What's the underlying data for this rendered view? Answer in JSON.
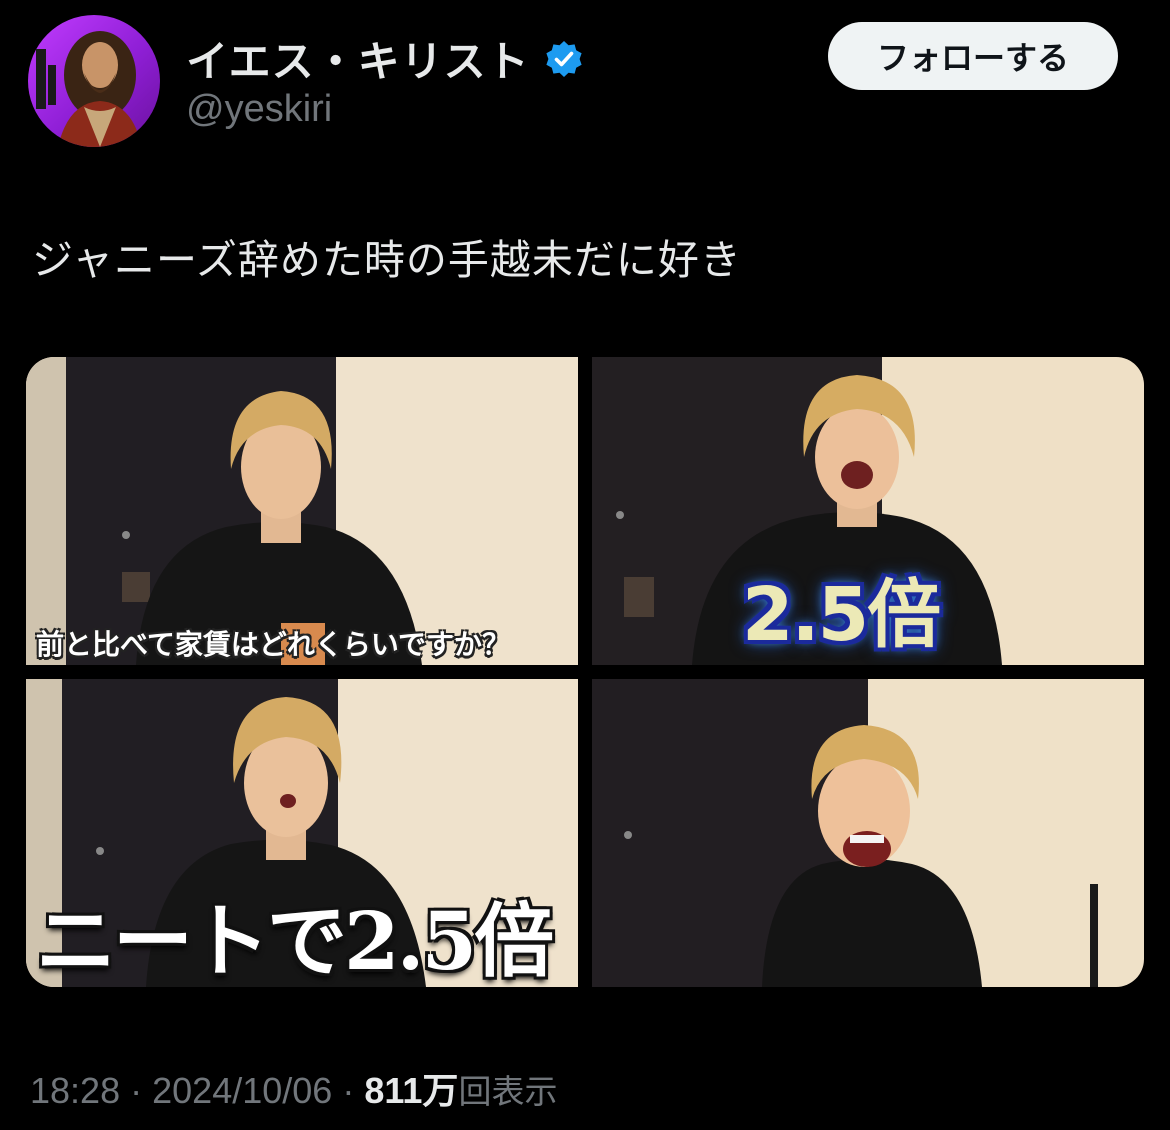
{
  "author": {
    "display_name": "イエス・キリスト",
    "handle": "@yeskiri",
    "verified": true,
    "avatar": "jesus-portrait-avatar"
  },
  "follow_button": {
    "label": "フォローする"
  },
  "tweet": {
    "text": "ジャニーズ辞めた時の手越未だに好き"
  },
  "media": {
    "frames": [
      {
        "caption": "前と比べて家賃はどれくらいですか？"
      },
      {
        "caption": "2.5倍"
      },
      {
        "caption": "ニートで2.5倍"
      },
      {
        "caption": ""
      }
    ]
  },
  "meta": {
    "time": "18:28",
    "separator": "·",
    "date": "2024/10/06",
    "views_count": "811万",
    "views_label": "回表示"
  },
  "colors": {
    "background": "#000000",
    "text": "#e7e9ea",
    "muted": "#71767b",
    "verified_badge": "#1d9bf0",
    "avatar_bg": "#b331f5"
  }
}
